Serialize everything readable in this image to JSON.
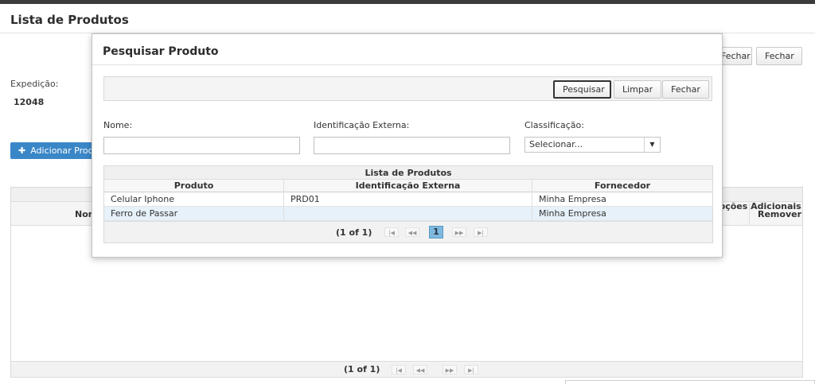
{
  "page": {
    "title": "Lista de Produtos",
    "buttons": {
      "fechar_a": "Fechar",
      "fechar_b": "Fechar"
    },
    "expedicao_label": "Expedição:",
    "expedicao_value": "12048",
    "add_button_label": "Adicionar Produto",
    "table": {
      "col_nome": "Nome",
      "col_opcoes": "Opções Adicionais",
      "col_remover": "Remover",
      "pager_info": "(1 of 1)"
    }
  },
  "dialog": {
    "title": "Pesquisar Produto",
    "toolbar": {
      "pesquisar": "Pesquisar",
      "limpar": "Limpar",
      "fechar": "Fechar"
    },
    "fields": {
      "nome_label": "Nome:",
      "nome_value": "",
      "idext_label": "Identificação Externa:",
      "idext_value": "",
      "class_label": "Classificação:",
      "class_value": "Selecionar..."
    },
    "table": {
      "caption": "Lista de Produtos",
      "headers": [
        "Produto",
        "Identificação Externa",
        "Fornecedor"
      ],
      "rows": [
        [
          "Celular Iphone",
          "PRD01",
          "Minha Empresa"
        ],
        [
          "Ferro de Passar",
          "",
          "Minha Empresa"
        ]
      ],
      "pager_info": "(1 of 1)",
      "current_page": "1"
    }
  },
  "colors": {
    "accent": "#3a87c8",
    "selected_row": "#e6f1f9",
    "page_current": "#7fb8de"
  }
}
